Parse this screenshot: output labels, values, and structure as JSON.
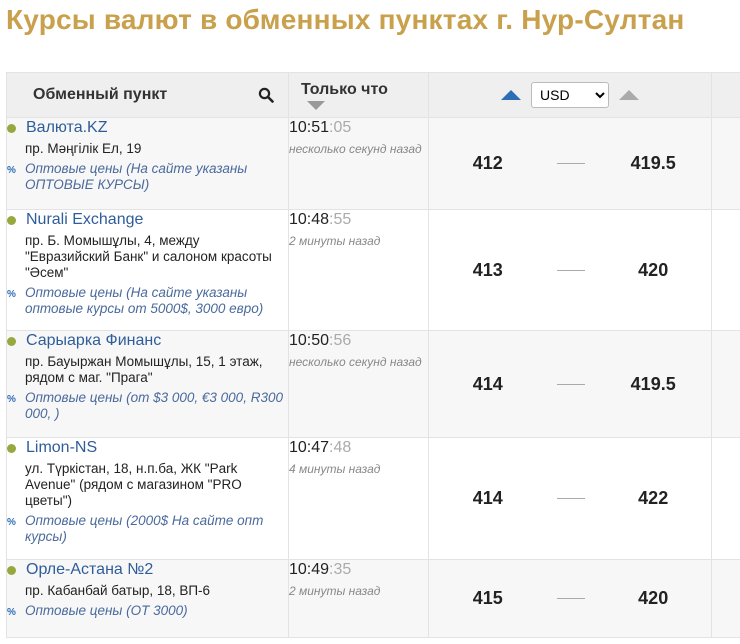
{
  "page_title": "Курсы валют в обменных пунктах г. Нур-Султан",
  "header": {
    "point_label": "Обменный пункт",
    "time_label": "Только что",
    "currency": "USD",
    "currency_options": [
      "USD"
    ]
  },
  "colors": {
    "title": "#c9a04c",
    "link": "#2f5d9a",
    "status_dot": "#98a83f",
    "sort_active": "#2f6db5",
    "sort_inactive": "#aaaaaa"
  },
  "rows": [
    {
      "name": "Валюта.KZ",
      "address": "пр. Мәңгілік Ел, 19",
      "note": "Оптовые цены (На сайте указаны ОПТОВЫЕ КУРСЫ)",
      "time": "10:51",
      "seconds": ":05",
      "ago": "несколько секунд назад",
      "buy": "412",
      "sell": "419.5"
    },
    {
      "name": "Nurali Exchange",
      "address": "пр. Б. Момышұлы, 4, между \"Евразийский Банк\" и салоном красоты \"Әсем\"",
      "note": "Оптовые цены (На сайте указаны оптовые курсы от 5000$, 3000 евро)",
      "time": "10:48",
      "seconds": ":55",
      "ago": "2 минуты назад",
      "buy": "413",
      "sell": "420"
    },
    {
      "name": "Сарыарка Финанс",
      "address": "пр. Бауыржан Момышұлы, 15, 1 этаж, рядом с маг. \"Прага\"",
      "note": "Оптовые цены (от $3 000, €3 000, R300 000, )",
      "time": "10:50",
      "seconds": ":56",
      "ago": "несколько секунд назад",
      "buy": "414",
      "sell": "419.5"
    },
    {
      "name": "Limon-NS",
      "address": "ул. Түркістан, 18, н.п.ба, ЖК \"Park Avenue\" (рядом с магазином \"PRO цветы\")",
      "note": "Оптовые цены (2000$ На сайте опт курсы)",
      "time": "10:47",
      "seconds": ":48",
      "ago": "4 минуты назад",
      "buy": "414",
      "sell": "422"
    },
    {
      "name": "Орле-Астана №2",
      "address": "пр. Кабанбай батыр, 18, ВП-6",
      "note": "Оптовые цены (ОТ 3000)",
      "time": "10:49",
      "seconds": ":35",
      "ago": "2 минуты назад",
      "buy": "415",
      "sell": "420"
    }
  ]
}
